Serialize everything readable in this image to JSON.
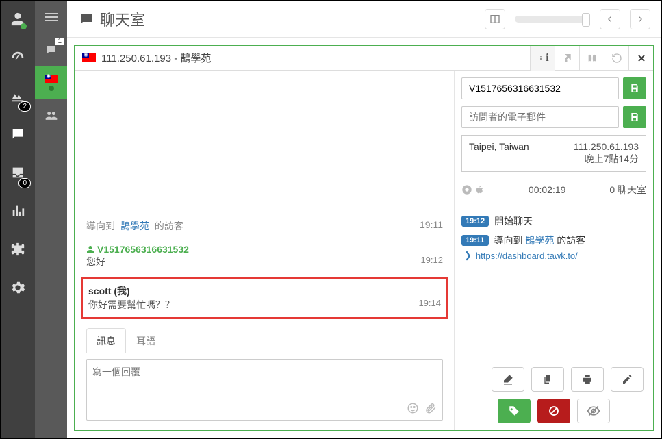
{
  "header": {
    "title": "聊天室"
  },
  "secondcol": {
    "count": "1"
  },
  "leftnav": {
    "badge_monitoring": "2",
    "badge_inbox": "0"
  },
  "chat": {
    "ip": "111.250.61.193",
    "site": "鵲學苑",
    "sep": " - ",
    "messages": {
      "sys1_prefix": "導向到 ",
      "sys1_link": "鵲學苑",
      "sys1_suffix": " 的訪客",
      "sys1_time": "19:11",
      "visitor_name": "V1517656316631532",
      "m1_text": "您好",
      "m1_time": "19:12",
      "me_label": "scott (我)",
      "m2_text": "你好需要幫忙嗎？？",
      "m2_time": "19:14"
    },
    "tabs": {
      "msg": "訊息",
      "whisper": "耳語"
    },
    "compose_placeholder": "寫一個回覆"
  },
  "details": {
    "name_value": "V1517656316631532",
    "email_placeholder": "訪問者的電子郵件",
    "location": "Taipei, Taiwan",
    "ip": "111.250.61.193",
    "localtime": "晚上7點14分",
    "duration": "00:02:19",
    "chatcount": "0 聊天室",
    "ev1_time": "19:12",
    "ev1_text": "開始聊天",
    "ev2_time": "19:11",
    "ev2_prefix": "導向到 ",
    "ev2_link": "鵲學苑",
    "ev2_suffix": " 的訪客",
    "url": "https://dashboard.tawk.to/"
  }
}
